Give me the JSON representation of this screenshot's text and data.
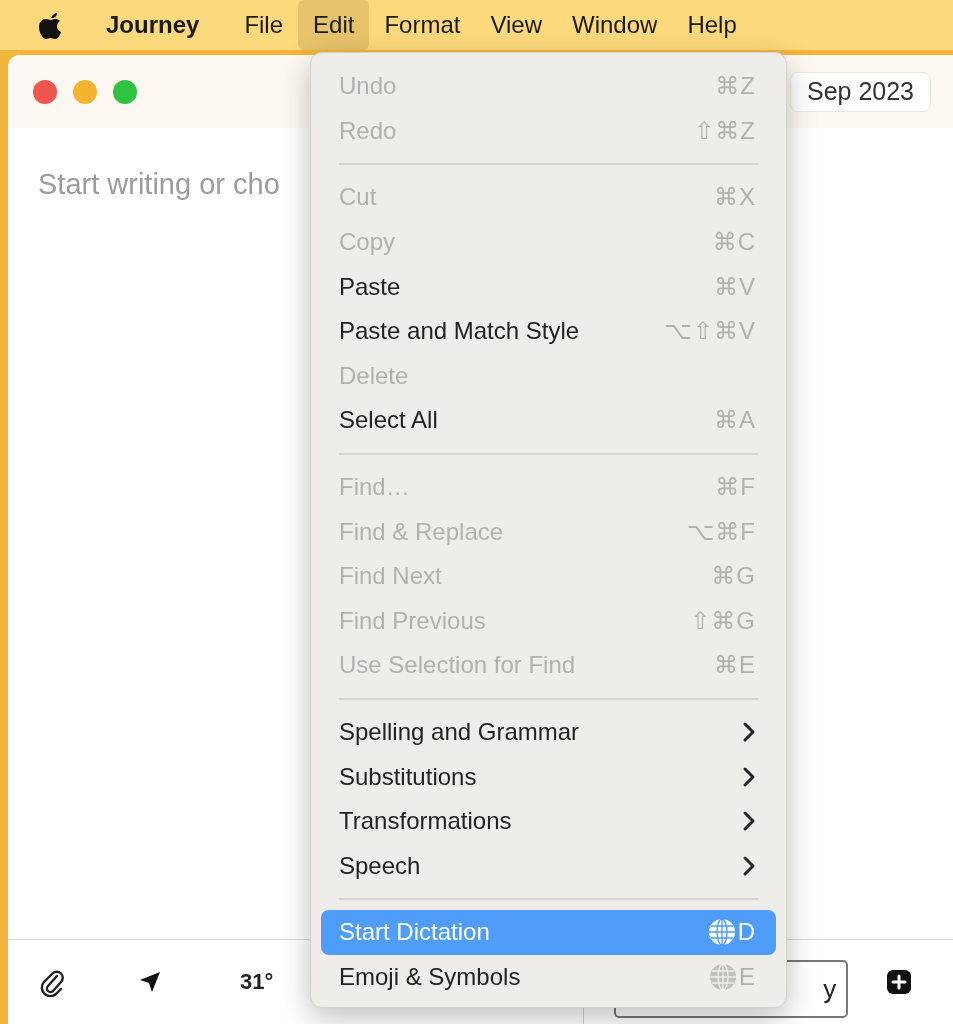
{
  "menu_bar": {
    "app_name": "Journey",
    "menus": [
      {
        "label": "File",
        "selected": false
      },
      {
        "label": "Edit",
        "selected": true
      },
      {
        "label": "Format",
        "selected": false
      },
      {
        "label": "View",
        "selected": false
      },
      {
        "label": "Window",
        "selected": false
      },
      {
        "label": "Help",
        "selected": false
      }
    ]
  },
  "window": {
    "date_button": "Sep 2023",
    "editor": {
      "placeholder": "Start writing or cho"
    },
    "toolbar": {
      "temperature": "31°",
      "button_2": "y"
    }
  },
  "edit_menu": {
    "groups": [
      [
        {
          "label": "Undo",
          "kind": "shortcut",
          "shortcut": "⌘Z",
          "disabled": true,
          "selected": false
        },
        {
          "label": "Redo",
          "kind": "shortcut",
          "shortcut": "⇧⌘Z",
          "disabled": true,
          "selected": false
        }
      ],
      [
        {
          "label": "Cut",
          "kind": "shortcut",
          "shortcut": "⌘X",
          "disabled": true,
          "selected": false
        },
        {
          "label": "Copy",
          "kind": "shortcut",
          "shortcut": "⌘C",
          "disabled": true,
          "selected": false
        },
        {
          "label": "Paste",
          "kind": "shortcut",
          "shortcut": "⌘V",
          "disabled": false,
          "selected": false
        },
        {
          "label": "Paste and Match Style",
          "kind": "shortcut",
          "shortcut": "⌥⇧⌘V",
          "disabled": false,
          "selected": false
        },
        {
          "label": "Delete",
          "kind": "plain",
          "disabled": true,
          "selected": false
        },
        {
          "label": "Select All",
          "kind": "shortcut",
          "shortcut": "⌘A",
          "disabled": false,
          "selected": false
        }
      ],
      [
        {
          "label": "Find…",
          "kind": "shortcut",
          "shortcut": "⌘F",
          "disabled": true,
          "selected": false
        },
        {
          "label": "Find & Replace",
          "kind": "shortcut",
          "shortcut": "⌥⌘F",
          "disabled": true,
          "selected": false
        },
        {
          "label": "Find Next",
          "kind": "shortcut",
          "shortcut": "⌘G",
          "disabled": true,
          "selected": false
        },
        {
          "label": "Find Previous",
          "kind": "shortcut",
          "shortcut": "⇧⌘G",
          "disabled": true,
          "selected": false
        },
        {
          "label": "Use Selection for Find",
          "kind": "shortcut",
          "shortcut": "⌘E",
          "disabled": true,
          "selected": false
        }
      ],
      [
        {
          "label": "Spelling and Grammar",
          "kind": "submenu",
          "disabled": false,
          "selected": false
        },
        {
          "label": "Substitutions",
          "kind": "submenu",
          "disabled": false,
          "selected": false
        },
        {
          "label": "Transformations",
          "kind": "submenu",
          "disabled": false,
          "selected": false
        },
        {
          "label": "Speech",
          "kind": "submenu",
          "disabled": false,
          "selected": false
        }
      ],
      [
        {
          "label": "Start Dictation",
          "kind": "globe",
          "shortcut": "D",
          "disabled": false,
          "selected": true
        },
        {
          "label": "Emoji & Symbols",
          "kind": "globe",
          "shortcut": "E",
          "disabled": false,
          "selected": false
        }
      ]
    ]
  }
}
